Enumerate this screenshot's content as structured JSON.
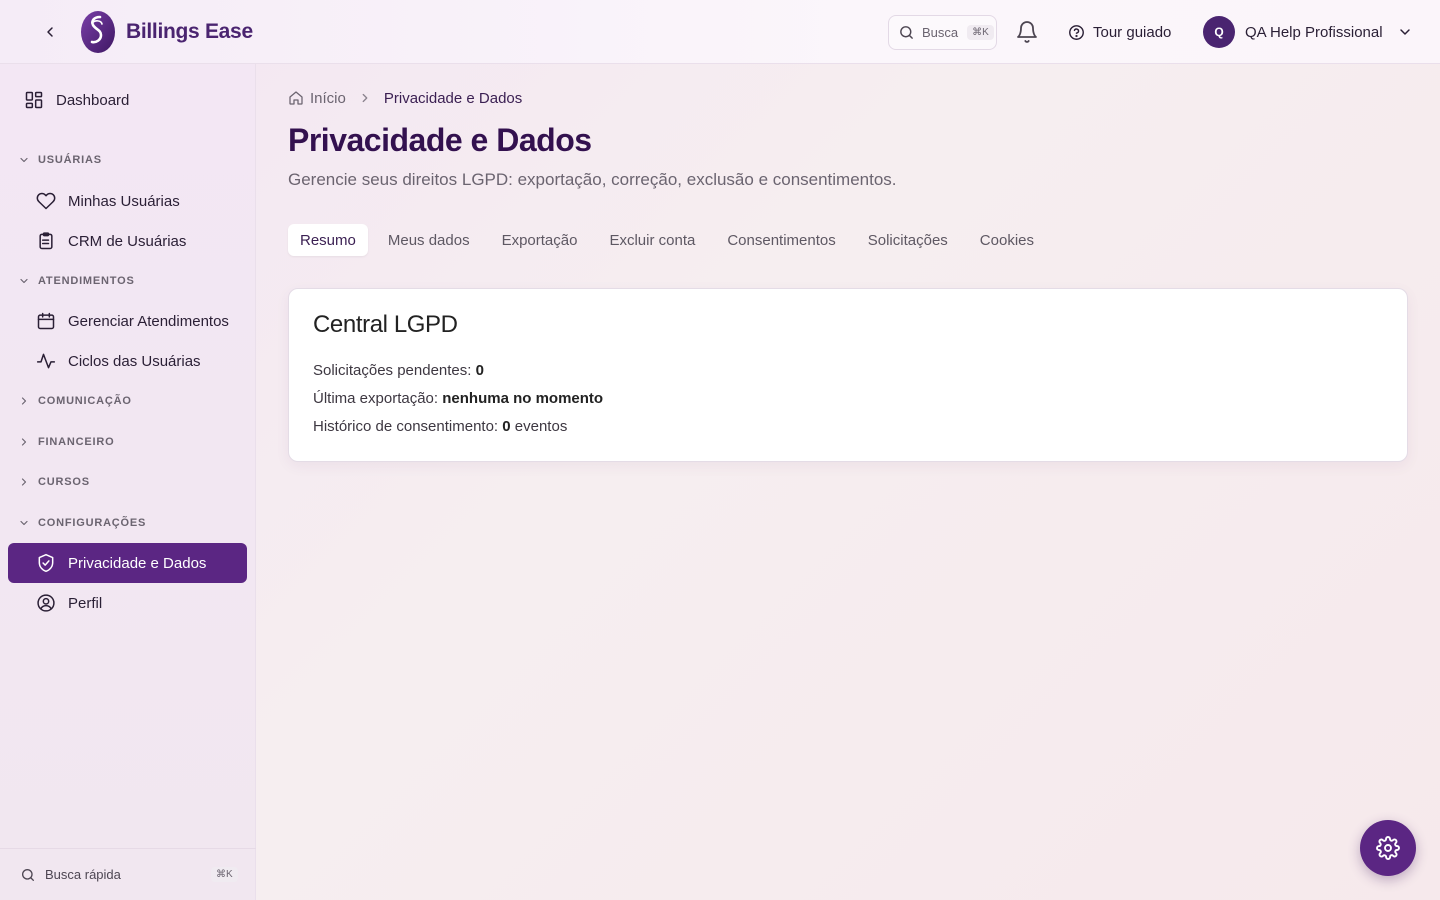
{
  "header": {
    "app_name": "Billings Ease",
    "search_label": "Busca",
    "search_shortcut": "⌘K",
    "tour_label": "Tour guiado",
    "user_initial": "Q",
    "user_name": "QA Help Profissional"
  },
  "sidebar": {
    "dashboard_label": "Dashboard",
    "sections": {
      "usuarias": "USUÁRIAS",
      "atendimentos": "ATENDIMENTOS",
      "comunicacao": "COMUNICAÇÃO",
      "financeiro": "FINANCEIRO",
      "cursos": "CURSOS",
      "configuracoes": "CONFIGURAÇÕES"
    },
    "items": {
      "minhas_usuarias": "Minhas Usuárias",
      "crm_usuarias": "CRM de Usuárias",
      "gerenciar_atendimentos": "Gerenciar Atendimentos",
      "ciclos_usuarias": "Ciclos das Usuárias",
      "privacidade_dados": "Privacidade e Dados",
      "perfil": "Perfil"
    },
    "quick_search_label": "Busca rápida",
    "quick_search_shortcut": "⌘K"
  },
  "breadcrumb": {
    "home": "Início",
    "current": "Privacidade e Dados"
  },
  "page": {
    "title": "Privacidade e Dados",
    "subtitle": "Gerencie seus direitos LGPD: exportação, correção, exclusão e consentimentos."
  },
  "tabs": [
    "Resumo",
    "Meus dados",
    "Exportação",
    "Excluir conta",
    "Consentimentos",
    "Solicitações",
    "Cookies"
  ],
  "card": {
    "title": "Central LGPD",
    "pending_label": "Solicitações pendentes:",
    "pending_value": "0",
    "export_label": "Última exportação:",
    "export_value": "nenhuma no momento",
    "consent_label": "Histórico de consentimento:",
    "consent_value": "0",
    "consent_suffix": "eventos"
  },
  "colors": {
    "brand": "#5b2683",
    "title": "#33114f"
  }
}
